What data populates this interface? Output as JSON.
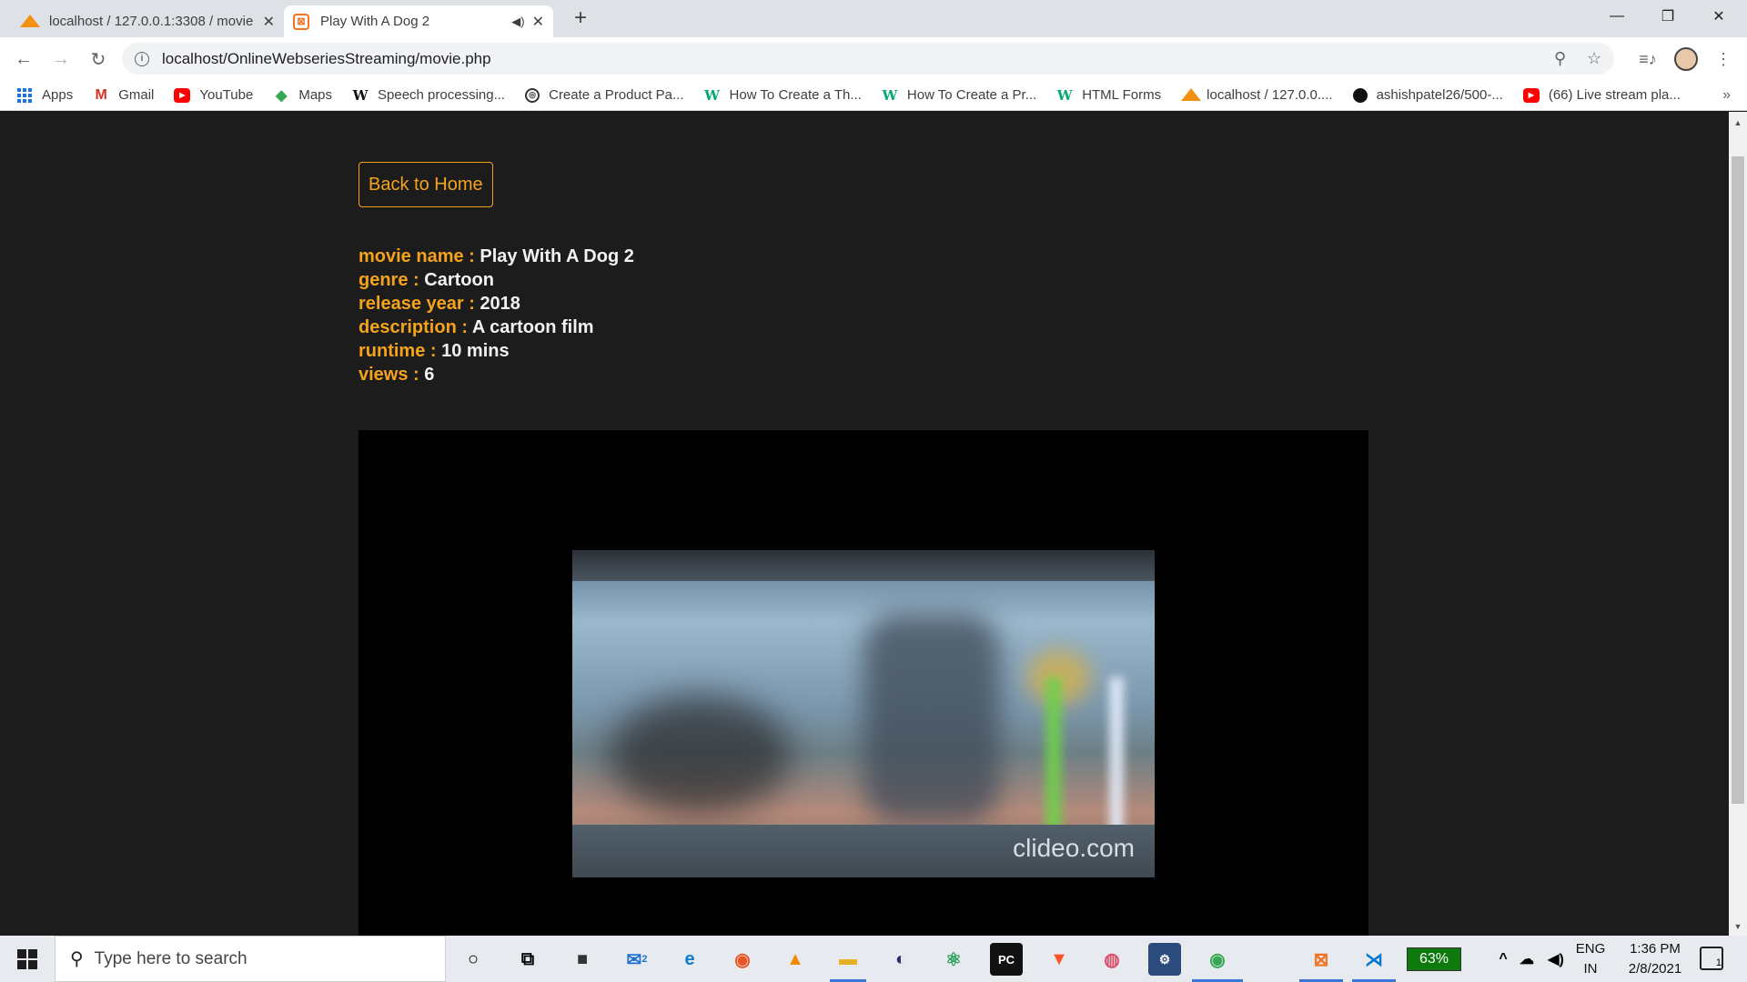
{
  "browser": {
    "tabs": [
      {
        "title": "localhost / 127.0.0.1:3308 / movie",
        "favicon": "phpmyadmin-icon"
      },
      {
        "title": "Play With A Dog 2",
        "favicon": "xampp-icon",
        "active": true
      }
    ],
    "url": "localhost/OnlineWebseriesStreaming/movie.php"
  },
  "bookmarks": [
    {
      "label": "Apps",
      "icon": "apps-grid-icon"
    },
    {
      "label": "Gmail",
      "icon": "gmail-icon"
    },
    {
      "label": "YouTube",
      "icon": "youtube-icon"
    },
    {
      "label": "Maps",
      "icon": "maps-icon"
    },
    {
      "label": "Speech processing...",
      "icon": "wikipedia-icon"
    },
    {
      "label": "Create a Product Pa...",
      "icon": "codepen-icon"
    },
    {
      "label": "How To Create a Th...",
      "icon": "w3schools-icon"
    },
    {
      "label": "How To Create a Pr...",
      "icon": "w3schools-icon"
    },
    {
      "label": "HTML Forms",
      "icon": "w3schools-icon"
    },
    {
      "label": "localhost / 127.0.0....",
      "icon": "phpmyadmin-icon"
    },
    {
      "label": "ashishpatel26/500-...",
      "icon": "github-icon"
    },
    {
      "label": "(66) Live stream pla...",
      "icon": "youtube-icon"
    }
  ],
  "page": {
    "back_button": "Back to Home",
    "details": [
      {
        "key": "movie name : ",
        "value": "Play With A Dog 2"
      },
      {
        "key": "genre : ",
        "value": "Cartoon"
      },
      {
        "key": "release year : ",
        "value": "2018"
      },
      {
        "key": "description : ",
        "value": "A cartoon film"
      },
      {
        "key": "runtime : ",
        "value": "10 mins"
      },
      {
        "key": "views : ",
        "value": "6"
      }
    ],
    "video_watermark": "clideo.com"
  },
  "taskbar": {
    "search_placeholder": "Type here to search",
    "battery": "63%",
    "language": "ENG",
    "region": "IN",
    "time": "1:36 PM",
    "date": "2/8/2021",
    "mail_badge": "2",
    "notification_count": "1"
  },
  "colors": {
    "accent": "#f5a31a",
    "page_bg": "#1c1c1c",
    "player_bg": "#000000"
  }
}
